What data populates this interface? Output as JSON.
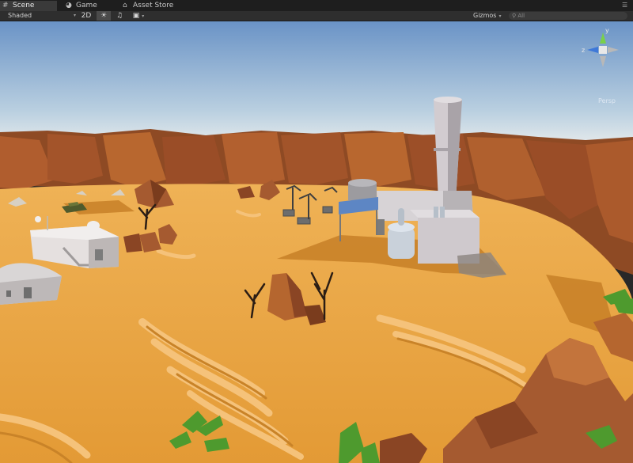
{
  "tabs": [
    {
      "label": "Scene",
      "icon": "scene-icon",
      "glyph": "#",
      "active": true
    },
    {
      "label": "Game",
      "icon": "game-icon",
      "glyph": "◕",
      "active": false
    },
    {
      "label": "Asset Store",
      "icon": "bag-icon",
      "glyph": "⌂",
      "active": false
    }
  ],
  "toolbar": {
    "shading_mode": "Shaded",
    "mode_2d": "2D",
    "lighting_glyph": "☀",
    "audio_glyph": "♫",
    "effects_glyph": "▣",
    "gizmos_label": "Gizmos",
    "search_placeholder": "All",
    "dropdown_glyph": "▾"
  },
  "gizmo": {
    "y_label": "y",
    "z_label": "z",
    "projection": "Persp"
  },
  "colors": {
    "sky_top": "#6a93c6",
    "sky_horizon": "#d9e4ea",
    "sand": "#e5a13b",
    "rock": "#a0522d",
    "building": "#d8d4d4",
    "billboard": "#5d86c4",
    "palm": "#4e9a2e"
  }
}
